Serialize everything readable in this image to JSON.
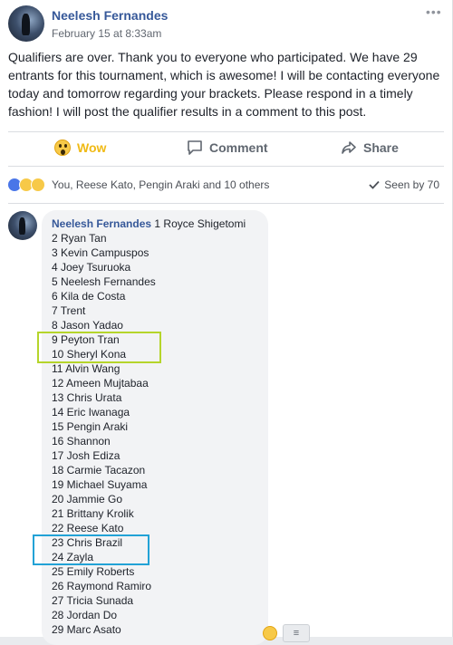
{
  "post": {
    "author": "Neelesh Fernandes",
    "timestamp": "February 15 at 8:33am",
    "body": "Qualifiers are over. Thank you to everyone who participated. We have 29 entrants for this tournament, which is awesome! I will be contacting everyone today and tomorrow regarding your brackets. Please respond in a timely fashion! I will post the qualifier results in a comment to this post.",
    "more_icon": "•••"
  },
  "actions": {
    "wow_label": "Wow",
    "comment_label": "Comment",
    "share_label": "Share"
  },
  "reactions": {
    "summary": "You, Reese Kato, Pengin Araki and 10 others",
    "seen_by": "Seen by 70"
  },
  "comment": {
    "author": "Neelesh Fernandes",
    "first_line": "1 Royce Shigetomi",
    "lines": [
      "2 Ryan Tan",
      "3 Kevin Campuspos",
      "4 Joey Tsuruoka",
      "5 Neelesh Fernandes",
      "6 Kila de Costa",
      "7 Trent",
      "8 Jason Yadao",
      "9 Peyton Tran",
      "10 Sheryl Kona",
      "11 Alvin Wang",
      "12 Ameen Mujtabaa",
      "13 Chris Urata",
      "14 Eric Iwanaga",
      "15 Pengin Araki",
      "16 Shannon",
      "17 Josh Ediza",
      "18 Carmie Tacazon",
      "19 Michael Suyama",
      "20 Jammie Go",
      "21 Brittany Krolik",
      "22 Reese Kato",
      "23 Chris Brazil",
      "24 Zayla",
      "25 Emily Roberts",
      "26 Raymond Ramiro",
      "27 Tricia Sunada",
      "28 Jordan Do",
      "29 Marc Asato"
    ]
  },
  "colors": {
    "link": "#365899",
    "wow": "#f0ba15",
    "highlight_green": "#b5d52b",
    "highlight_blue": "#22a2d6"
  }
}
